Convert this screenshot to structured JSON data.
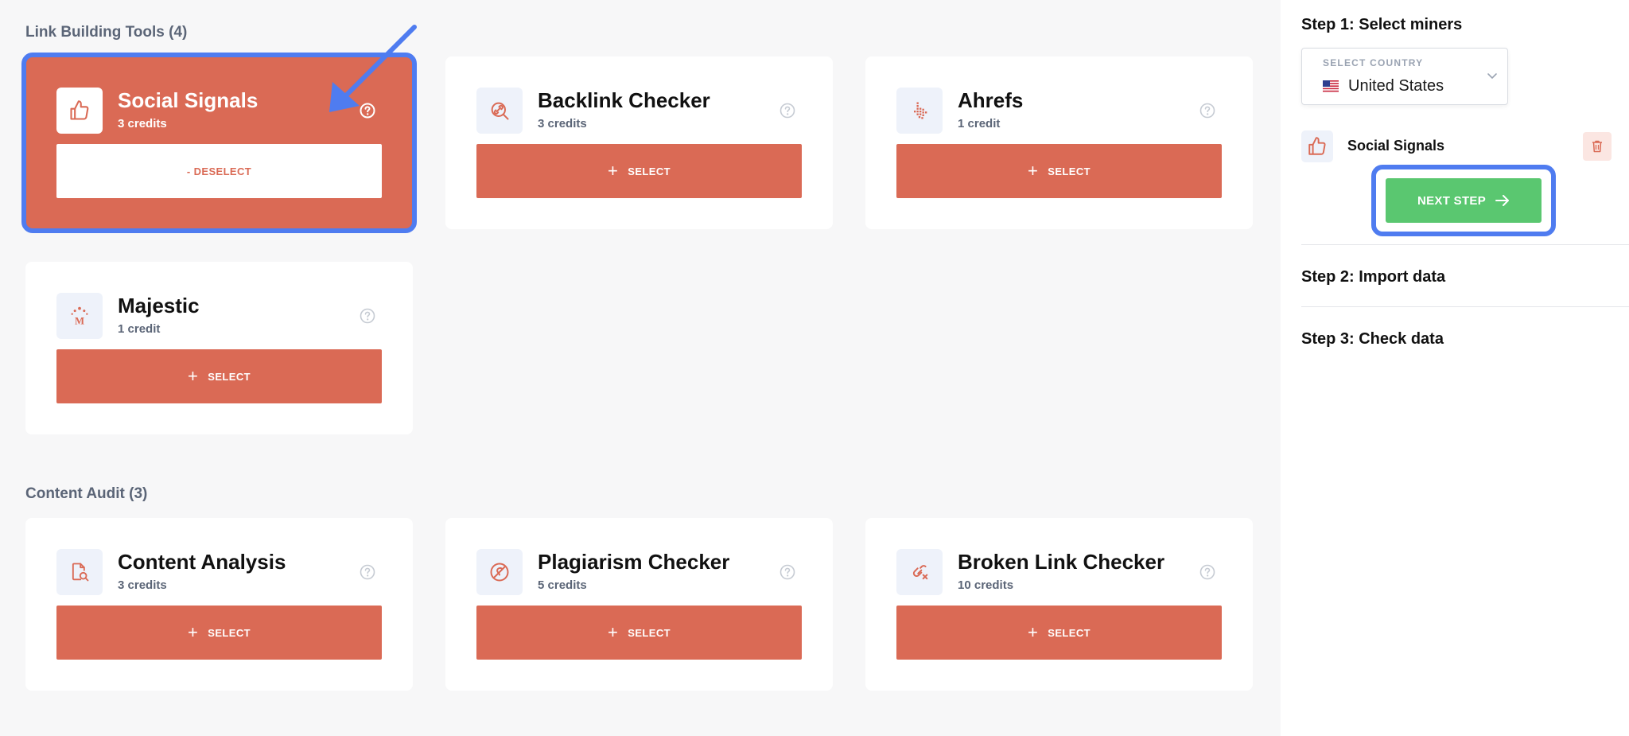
{
  "sections": {
    "link_building": {
      "title": "Link Building Tools (4)"
    },
    "content_audit": {
      "title": "Content Audit (3)"
    }
  },
  "tools": [
    {
      "name": "Social Signals",
      "credits": "3 credits",
      "icon": "thumbs-up-icon",
      "button": "- DESELECT",
      "selected": true
    },
    {
      "name": "Backlink Checker",
      "credits": "3 credits",
      "icon": "link-search-icon",
      "button": "SELECT",
      "selected": false
    },
    {
      "name": "Ahrefs",
      "credits": "1 credit",
      "icon": "ahrefs-pointer-icon",
      "button": "SELECT",
      "selected": false
    },
    {
      "name": "Majestic",
      "credits": "1 credit",
      "icon": "majestic-logo-icon",
      "button": "SELECT",
      "selected": false
    },
    {
      "name": "Content Analysis",
      "credits": "3 credits",
      "icon": "document-search-icon",
      "button": "SELECT",
      "selected": false
    },
    {
      "name": "Plagiarism Checker",
      "credits": "5 credits",
      "icon": "plagiarism-icon",
      "button": "SELECT",
      "selected": false
    },
    {
      "name": "Broken Link Checker",
      "credits": "10 credits",
      "icon": "broken-link-icon",
      "button": "SELECT",
      "selected": false
    }
  ],
  "sidebar": {
    "step1": "Step 1: Select miners",
    "country_caption": "SELECT COUNTRY",
    "country_value": "United States",
    "selected_miner": "Social Signals",
    "next_button": "NEXT STEP",
    "step2": "Step 2: Import data",
    "step3": "Step 3: Check data"
  },
  "colors": {
    "accent": "#da6a55",
    "success": "#5ac770",
    "highlight": "#4f7cf0"
  }
}
